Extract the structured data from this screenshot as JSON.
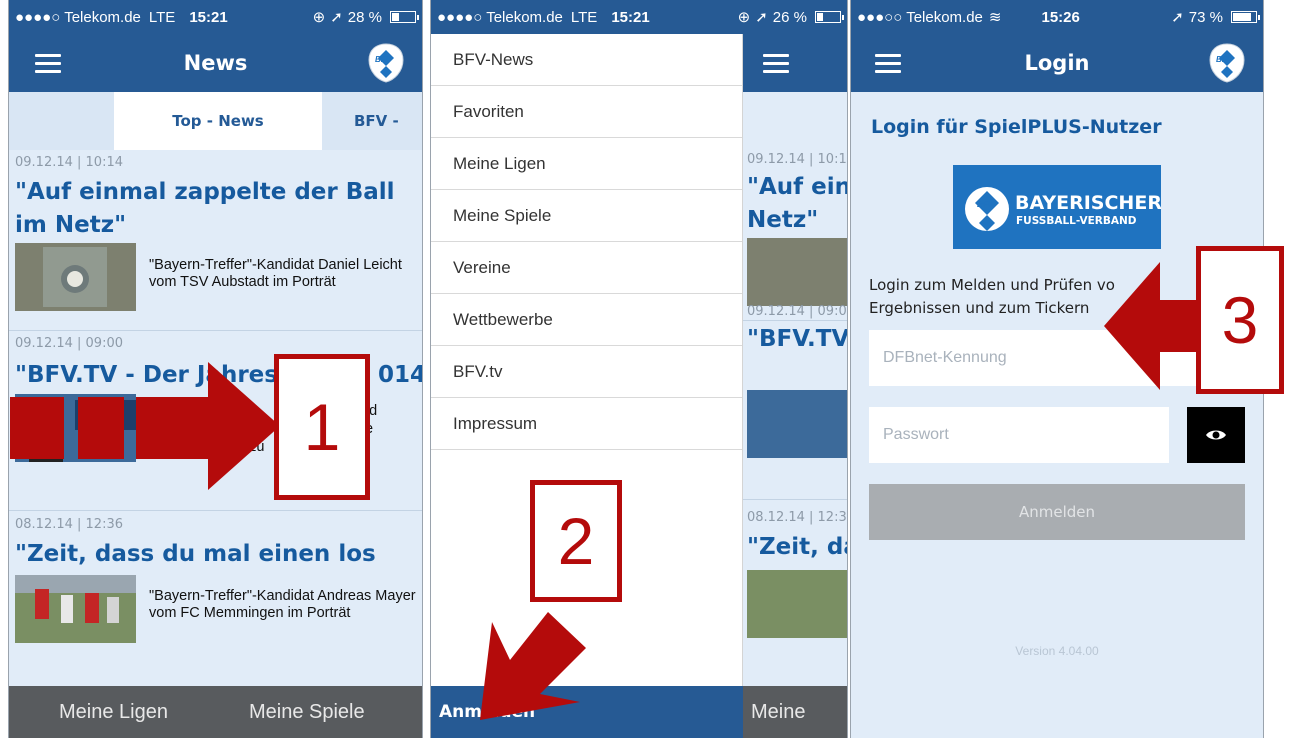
{
  "phone1": {
    "status": {
      "carrier": "●●●●○ Telekom.de",
      "network": "LTE",
      "time": "15:21",
      "battery": "28 %",
      "battery_level": 0.28
    },
    "nav": {
      "title": "News"
    },
    "tabs": [
      {
        "label": "Top - News"
      },
      {
        "label": "BFV -"
      }
    ],
    "news": [
      {
        "date": "09.12.14 | 10:14",
        "title": "\"Auf einmal zappelte der Ball im Netz\"",
        "teaser": "\"Bayern-Treffer\"-Kandidat Daniel Leicht vom TSV Aubstadt im Porträt"
      },
      {
        "date": "09.12.14 | 09:00",
        "title": "\"BFV.TV - Der Jahresrüc",
        "title_end": "014\"",
        "teaser_frag1": "-Prä",
        "teaser_frag1b": "nd",
        "teaser_frag2": "pp",
        "teaser_frag2b": "e",
        "teaser_frag3": "4 zu"
      },
      {
        "date": "08.12.14 | 12:36",
        "title": "\"Zeit, dass du mal einen los lässt\"",
        "teaser": "\"Bayern-Treffer\"-Kandidat Andreas Mayer vom FC Memmingen im Porträt"
      }
    ],
    "bottom": {
      "left": "Meine Ligen",
      "right": "Meine Spiele"
    }
  },
  "phone2": {
    "status": {
      "carrier": "●●●●○ Telekom.de",
      "network": "LTE",
      "time": "15:21",
      "battery": "26 %",
      "battery_level": 0.26
    },
    "menu": [
      "BFV-News",
      "Favoriten",
      "Meine Ligen",
      "Meine Spiele",
      "Vereine",
      "Wettbewerbe",
      "BFV.tv",
      "Impressum"
    ],
    "menu_bottom": "Anmelden",
    "peek": {
      "date1": "09.12.14 | 10:1",
      "title1a": "\"Auf einr",
      "title1b": "Netz\"",
      "date2": "09.12.14 | 09:0",
      "title2": "\"BFV.TV -",
      "date3": "08.12.14 | 12:3",
      "title3": "\"Zeit, das",
      "bottom": "Meine"
    }
  },
  "phone3": {
    "status": {
      "carrier": "●●●○○ Telekom.de",
      "time": "15:26",
      "battery": "73 %",
      "battery_level": 0.73
    },
    "nav": {
      "title": "Login"
    },
    "heading": "Login für SpielPLUS-Nutzer",
    "banner": {
      "line1": "BAYERISCHER",
      "line2": "FUSSBALL-VERBAND"
    },
    "description_line1": "Login zum Melden und Prüfen vo",
    "description_line2": "Ergebnissen und zum Tickern",
    "username_placeholder": "DFBnet-Kennung",
    "password_placeholder": "Passwort",
    "submit": "Anmelden",
    "version": "Version 4.04.00"
  },
  "logo_text": "BFV",
  "annotations": [
    "1",
    "2",
    "3"
  ],
  "colors": {
    "brand_blue": "#265a94",
    "title_blue": "#165a9e",
    "annotation_red": "#b40b0b",
    "bottom_bar": "#585b5e"
  }
}
